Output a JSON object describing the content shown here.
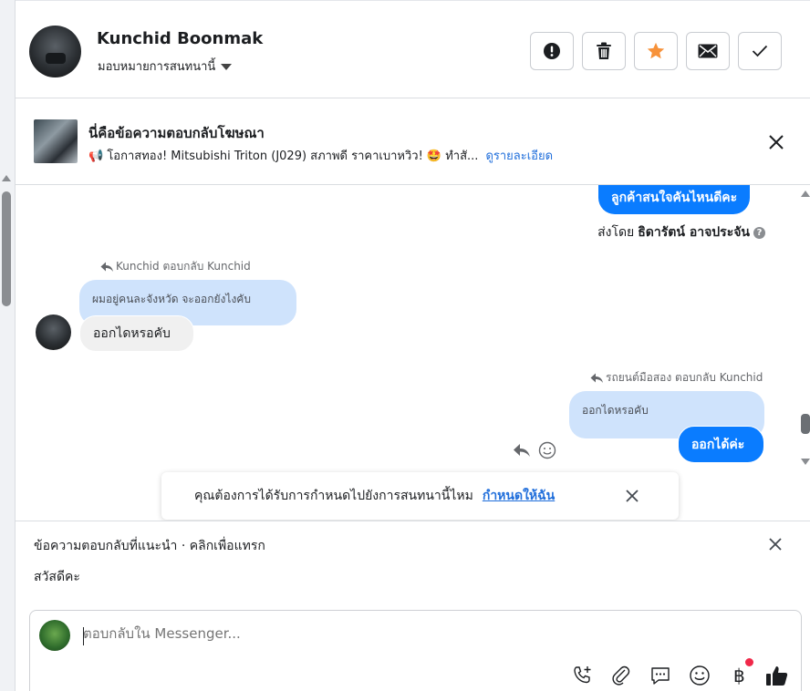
{
  "header": {
    "contact_name": "Kunchid Boonmak",
    "assign_label": "มอบหมายการสนทนานี้",
    "buttons": [
      "spam",
      "delete",
      "star",
      "mark-unread",
      "done"
    ],
    "accent_star": "#f7923a"
  },
  "ad": {
    "title": "นี่คือข้อความตอบกลับโฆษณา",
    "description": "📢 โอกาสทอง! Mitsubishi Triton (J029) สภาพดี ราคาเบาหวิว! 🤩 ทำสั...",
    "link": "ดูรายละเอียด"
  },
  "conversation": {
    "top_bubble": "ลูกค้าสนใจคันไหนดีคะ",
    "sent_by_prefix": "ส่งโดย",
    "sent_by_name": "ธิดารัตน์ อาจประจัน",
    "reply_note_1": "Kunchid ตอบกลับ Kunchid",
    "quote_1": "ผมอยู่คนละจังหวัด จะออกยังไงคับ",
    "msg_1": "ออกไดหรอคับ",
    "reply_note_2": "รถยนต์มือสอง ตอบกลับ Kunchid",
    "quote_2": "ออกไดหรอคับ",
    "msg_2": "ออกได้ค่ะ",
    "bubble_blue": "#0a7cff"
  },
  "reminder": {
    "text": "คุณต้องการได้รับการกำหนดไปยังการสนทนานี้ไหม",
    "link": "กำหนดให้ฉัน"
  },
  "suggestions": {
    "header": "ข้อความตอบกลับที่แนะนำ · คลิกเพื่อแทรก",
    "items": [
      "สวัสดีคะ"
    ]
  },
  "composer": {
    "placeholder": "ตอบกลับใน Messenger...",
    "tools": [
      "call-add-icon",
      "attachment-icon",
      "saved-reply-icon",
      "emoji-icon",
      "baht-icon",
      "like-icon"
    ]
  }
}
